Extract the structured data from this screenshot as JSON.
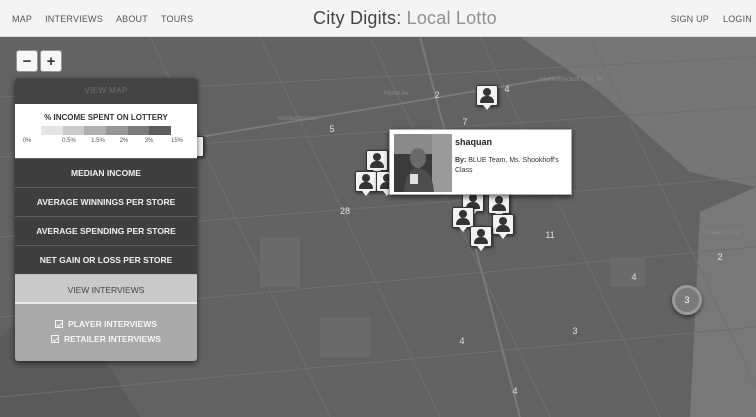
{
  "nav": {
    "left_links": [
      "MAP",
      "INTERVIEWS",
      "ABOUT",
      "TOURS"
    ],
    "title_main": "City Digits: ",
    "title_accent": "Local Lotto",
    "right_links": [
      "SIGN UP",
      "LOGIN"
    ]
  },
  "zoom": {
    "out_label": "−",
    "in_label": "+"
  },
  "panel": {
    "view_map": "VIEW MAP",
    "legend": {
      "title": "% INCOME SPENT ON LOTTERY",
      "ticks": [
        "0%",
        "0.5%",
        "1.5%",
        "2%",
        "3%",
        "15%"
      ],
      "colors": [
        "#e4e4e4",
        "#cacaca",
        "#b0b0b0",
        "#969696",
        "#7a7a7a",
        "#5c5c5c"
      ]
    },
    "options": [
      "MEDIAN INCOME",
      "AVERAGE WINNINGS PER STORE",
      "AVERAGE SPENDING PER STORE",
      "NET GAIN OR LOSS PER STORE"
    ],
    "view_interviews": "VIEW INTERVIEWS",
    "checkboxes": [
      "PLAYER INTERVIEWS",
      "RETAILER INTERVIEWS"
    ]
  },
  "popup": {
    "name": "shaquan",
    "by_label": "By:",
    "by_text": " BLUE Team, Ms. Shookhoff's Class"
  },
  "clusters": [
    "2",
    "4",
    "7",
    "5",
    "28",
    "11",
    "4",
    "2",
    "3",
    "4",
    "3",
    "4"
  ],
  "streets": [
    "Myrtle-Wyckoff Av (L,M)",
    "Knickerbocker",
    "Halsey St (L)",
    "Myrtle Av"
  ],
  "colors": {
    "nav_bg": "#f4f4f4",
    "map_bg": "#626262",
    "panel_bg": "#484848"
  }
}
